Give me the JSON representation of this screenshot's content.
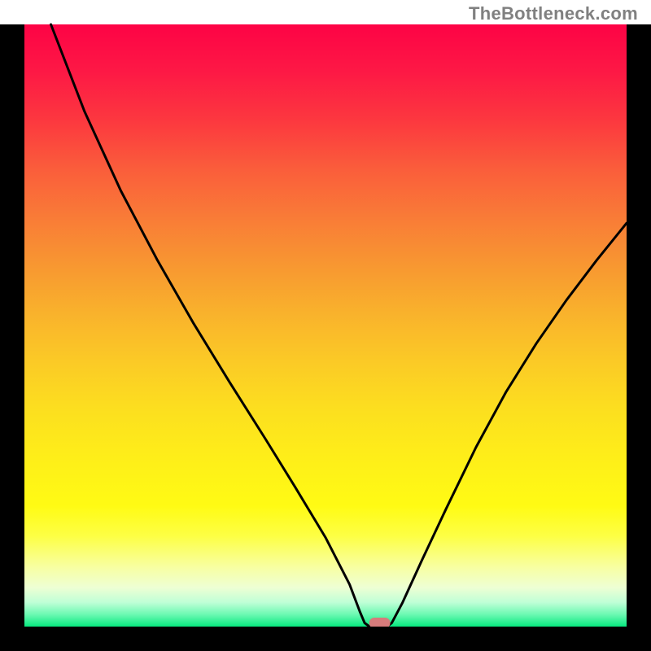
{
  "watermark": "TheBottleneck.com",
  "chart_data": {
    "type": "line",
    "title": "",
    "xlabel": "",
    "ylabel": "",
    "xlim": [
      0,
      100
    ],
    "ylim": [
      0,
      100
    ],
    "grid": false,
    "legend": false,
    "marker": {
      "x": 59,
      "y": 0,
      "color": "#d67b7b"
    },
    "curve_points": [
      {
        "x": 4.4,
        "y": 100.0
      },
      {
        "x": 10.0,
        "y": 85.5
      },
      {
        "x": 16.0,
        "y": 72.4
      },
      {
        "x": 22.0,
        "y": 61.0
      },
      {
        "x": 28.0,
        "y": 50.5
      },
      {
        "x": 34.0,
        "y": 40.7
      },
      {
        "x": 40.0,
        "y": 31.2
      },
      {
        "x": 45.0,
        "y": 23.1
      },
      {
        "x": 50.0,
        "y": 14.8
      },
      {
        "x": 54.0,
        "y": 7.0
      },
      {
        "x": 55.7,
        "y": 2.5
      },
      {
        "x": 56.5,
        "y": 0.6
      },
      {
        "x": 57.3,
        "y": 0.0
      },
      {
        "x": 60.2,
        "y": 0.0
      },
      {
        "x": 61.0,
        "y": 0.6
      },
      {
        "x": 62.8,
        "y": 4.0
      },
      {
        "x": 66.0,
        "y": 11.0
      },
      {
        "x": 70.0,
        "y": 19.5
      },
      {
        "x": 75.0,
        "y": 29.8
      },
      {
        "x": 80.0,
        "y": 39.0
      },
      {
        "x": 85.0,
        "y": 47.0
      },
      {
        "x": 90.0,
        "y": 54.2
      },
      {
        "x": 95.0,
        "y": 60.8
      },
      {
        "x": 100.0,
        "y": 67.0
      }
    ],
    "gradient_bands": [
      {
        "offset": 0.0,
        "color": "#fd0345"
      },
      {
        "offset": 0.08,
        "color": "#fd1945"
      },
      {
        "offset": 0.16,
        "color": "#fc383f"
      },
      {
        "offset": 0.24,
        "color": "#fa5d3b"
      },
      {
        "offset": 0.32,
        "color": "#f97b37"
      },
      {
        "offset": 0.4,
        "color": "#f89731"
      },
      {
        "offset": 0.48,
        "color": "#f9b22c"
      },
      {
        "offset": 0.56,
        "color": "#fbca26"
      },
      {
        "offset": 0.64,
        "color": "#fcdf1f"
      },
      {
        "offset": 0.72,
        "color": "#feee19"
      },
      {
        "offset": 0.8,
        "color": "#fffb14"
      },
      {
        "offset": 0.85,
        "color": "#fdff45"
      },
      {
        "offset": 0.9,
        "color": "#f8ffa0"
      },
      {
        "offset": 0.935,
        "color": "#eeffd4"
      },
      {
        "offset": 0.96,
        "color": "#bfffd6"
      },
      {
        "offset": 0.98,
        "color": "#6bf9b2"
      },
      {
        "offset": 1.0,
        "color": "#07e97f"
      }
    ]
  },
  "layout": {
    "size": 800,
    "border_width": 30,
    "top_gap": 30,
    "curve_stroke": 3,
    "border_color": "#000000",
    "curve_color": "#000000"
  }
}
